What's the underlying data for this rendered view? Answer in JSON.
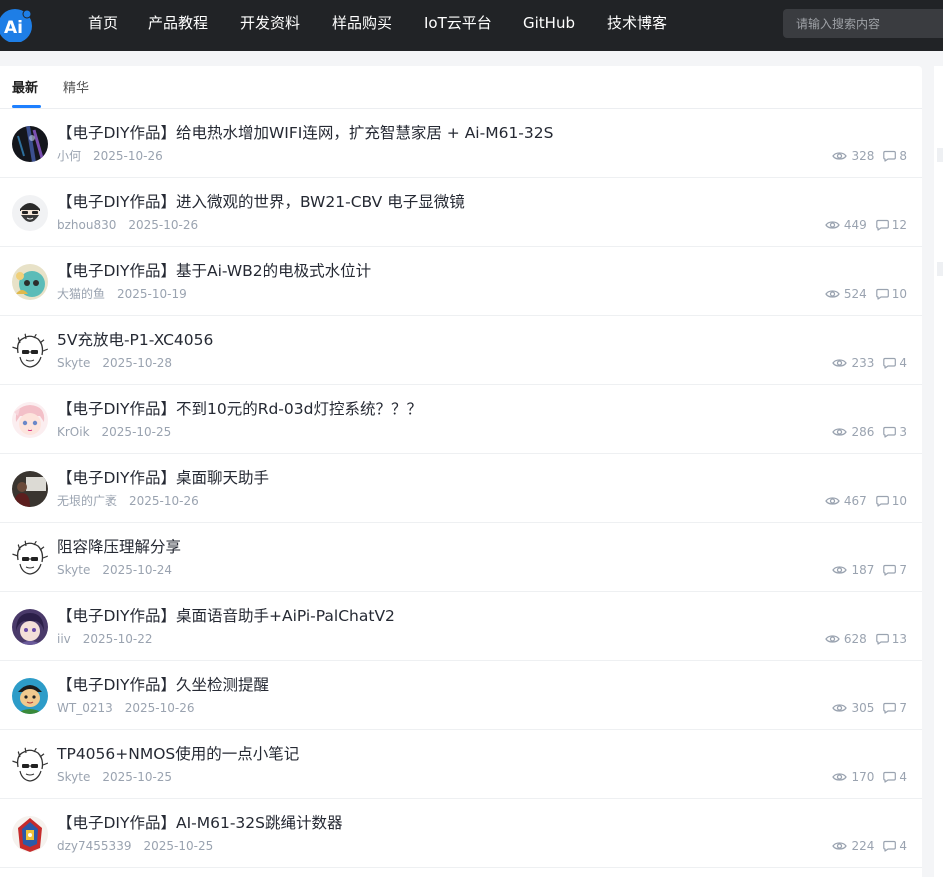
{
  "nav": {
    "logo_text": "Ai",
    "items": [
      "首页",
      "产品教程",
      "开发资料",
      "样品购买",
      "IoT云平台",
      "GitHub",
      "技术博客"
    ],
    "search_placeholder": "请输入搜索内容"
  },
  "tabs": [
    "最新",
    "精华"
  ],
  "colors": {
    "accent": "#1e80ff",
    "topbar": "#212326",
    "meta": "#9aa3b0"
  },
  "posts": [
    {
      "title": "【电子DIY作品】给电热水增加WIFI连网，扩充智慧家居 + Ai-M61-32S",
      "author": "小何",
      "date": "2025-10-26",
      "views": "328",
      "comments": "8",
      "avatar": "dark-photo"
    },
    {
      "title": "【电子DIY作品】进入微观的世界，BW21-CBV 电子显微镜",
      "author": "bzhou830",
      "date": "2025-10-26",
      "views": "449",
      "comments": "12",
      "avatar": "bearded-cartoon"
    },
    {
      "title": "【电子DIY作品】基于Ai-WB2的电极式水位计",
      "author": "大猫的鱼",
      "date": "2025-10-19",
      "views": "524",
      "comments": "10",
      "avatar": "teal-cartoon"
    },
    {
      "title": "5V充放电-P1-XC4056",
      "author": "Skyte",
      "date": "2025-10-28",
      "views": "233",
      "comments": "4",
      "avatar": "sketch-face"
    },
    {
      "title": "【电子DIY作品】不到10元的Rd-03d灯控系统？？？",
      "author": "KrOik",
      "date": "2025-10-25",
      "views": "286",
      "comments": "3",
      "avatar": "pink-anime"
    },
    {
      "title": "【电子DIY作品】桌面聊天助手",
      "author": "无垠的广袤",
      "date": "2025-10-26",
      "views": "467",
      "comments": "10",
      "avatar": "presenter-photo"
    },
    {
      "title": "阻容降压理解分享",
      "author": "Skyte",
      "date": "2025-10-24",
      "views": "187",
      "comments": "7",
      "avatar": "sketch-face"
    },
    {
      "title": "【电子DIY作品】桌面语音助手+AiPi-PalChatV2",
      "author": "iiv",
      "date": "2025-10-22",
      "views": "628",
      "comments": "13",
      "avatar": "purple-anime"
    },
    {
      "title": "【电子DIY作品】久坐检测提醒",
      "author": "WT_0213",
      "date": "2025-10-26",
      "views": "305",
      "comments": "7",
      "avatar": "green-cartoon"
    },
    {
      "title": "TP4056+NMOS使用的一点小笔记",
      "author": "Skyte",
      "date": "2025-10-25",
      "views": "170",
      "comments": "4",
      "avatar": "sketch-face"
    },
    {
      "title": "【电子DIY作品】AI-M61-32S跳绳计数器",
      "author": "dzy7455339",
      "date": "2025-10-25",
      "views": "224",
      "comments": "4",
      "avatar": "robot-red"
    }
  ]
}
